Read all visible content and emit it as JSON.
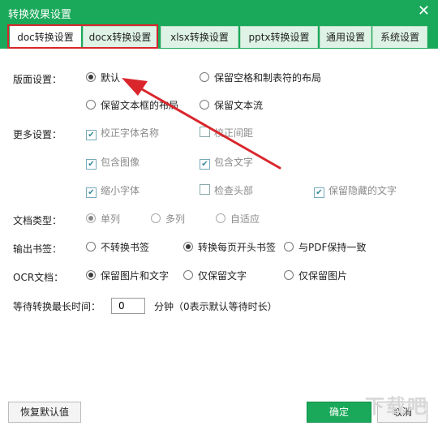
{
  "window": {
    "title": "转换效果设置",
    "close_glyph": "✕"
  },
  "tabs": [
    {
      "label": "doc转换设置",
      "active": true
    },
    {
      "label": "docx转换设置",
      "active": false
    },
    {
      "label": "xlsx转换设置",
      "active": false
    },
    {
      "label": "pptx转换设置",
      "active": false
    },
    {
      "label": "通用设置",
      "active": false
    },
    {
      "label": "系统设置",
      "active": false
    }
  ],
  "layout_settings": {
    "label": "版面设置：",
    "options": [
      {
        "label": "默认",
        "selected": true
      },
      {
        "label": "保留空格和制表符的布局",
        "selected": false
      },
      {
        "label": "保留文本框的布局",
        "selected": false
      },
      {
        "label": "保留文本流",
        "selected": false
      }
    ]
  },
  "more_settings": {
    "label": "更多设置：",
    "options": [
      {
        "label": "校正字体名称",
        "checked": true
      },
      {
        "label": "校正间距",
        "checked": false
      },
      {
        "label": "包含图像",
        "checked": true
      },
      {
        "label": "包含文字",
        "checked": true
      },
      {
        "label": "缩小字体",
        "checked": true
      },
      {
        "label": "检查头部",
        "checked": false
      },
      {
        "label": "保留隐藏的文字",
        "checked": true
      }
    ]
  },
  "doc_type": {
    "label": "文档类型：",
    "options": [
      {
        "label": "单列",
        "selected": true
      },
      {
        "label": "多列",
        "selected": false
      },
      {
        "label": "自适应",
        "selected": false
      }
    ]
  },
  "bookmarks": {
    "label": "输出书签：",
    "options": [
      {
        "label": "不转换书签",
        "selected": false
      },
      {
        "label": "转换每页开头书签",
        "selected": true
      },
      {
        "label": "与PDF保持一致",
        "selected": false
      }
    ]
  },
  "ocr": {
    "label": "OCR文档：",
    "options": [
      {
        "label": "保留图片和文字",
        "selected": true
      },
      {
        "label": "仅保留文字",
        "selected": false
      },
      {
        "label": "仅保留图片",
        "selected": false
      }
    ]
  },
  "wait_time": {
    "label": "等待转换最长时间：",
    "value": "0",
    "unit_note": "分钟（0表示默认等待时长）"
  },
  "buttons": {
    "reset": "恢复默认值",
    "ok": "确定",
    "cancel": "取消"
  },
  "watermark": "下载吧",
  "colors": {
    "accent": "#1aa95a",
    "highlight": "#d9262c"
  }
}
